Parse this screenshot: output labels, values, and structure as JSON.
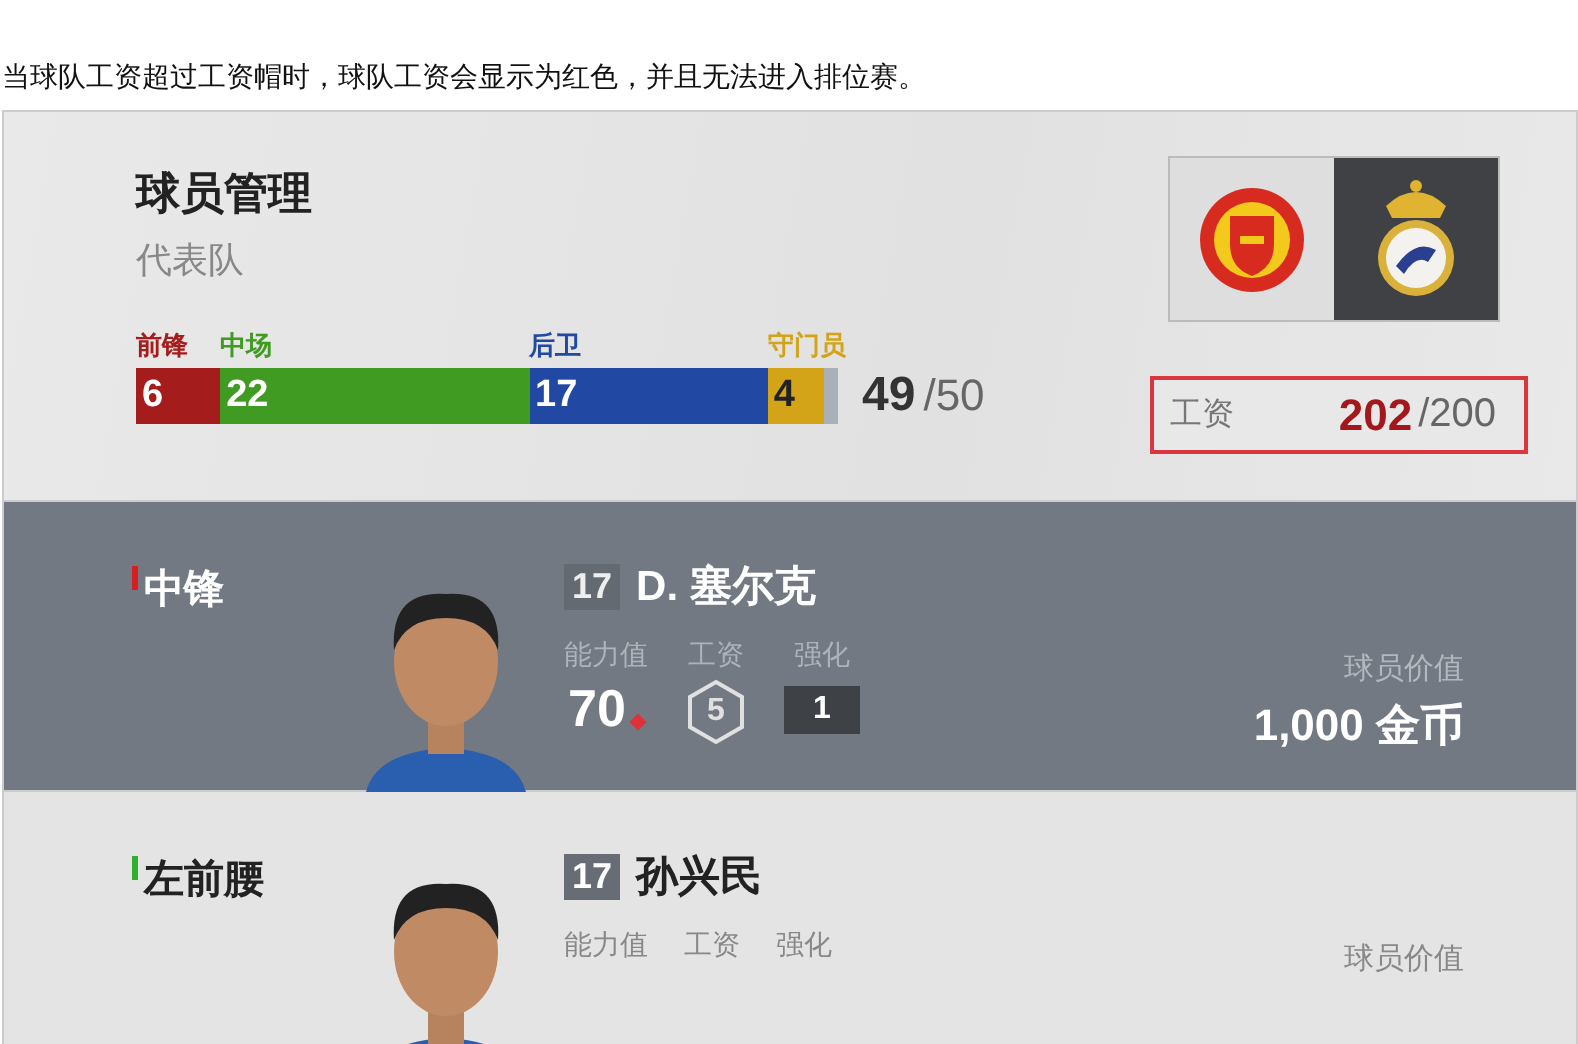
{
  "caption": "当球队工资超过工资帽时，球队工资会显示为红色，并且无法进入排位赛。",
  "header": {
    "title": "球员管理",
    "subtitle": "代表队",
    "positions": [
      {
        "label": "前锋",
        "count": "6",
        "color": "#a51c1c"
      },
      {
        "label": "中场",
        "count": "22",
        "color": "#3f9b22"
      },
      {
        "label": "后卫",
        "count": "17",
        "color": "#2149a3"
      },
      {
        "label": "守门员",
        "count": "4",
        "color": "#d4a418"
      }
    ],
    "squad_total": "49",
    "squad_max": "/50",
    "clubs": [
      {
        "selected": false
      },
      {
        "selected": true
      }
    ],
    "salary": {
      "label": "工资",
      "value": "202",
      "max": "/200",
      "over_cap": true
    }
  },
  "players": [
    {
      "position": "中锋",
      "color": "#d81e1e",
      "selected": true,
      "number": "17",
      "name": "D. 塞尔克",
      "stat_labels": [
        "能力值",
        "工资",
        "强化"
      ],
      "rating": "70",
      "salary": "5",
      "upgrade": "1",
      "value_label": "球员价值",
      "value": "1,000 金币"
    },
    {
      "position": "左前腰",
      "color": "#2fae2f",
      "selected": false,
      "number": "17",
      "name": "孙兴民",
      "stat_labels": [
        "能力值",
        "工资",
        "强化"
      ],
      "value_label": "球员价值"
    }
  ]
}
